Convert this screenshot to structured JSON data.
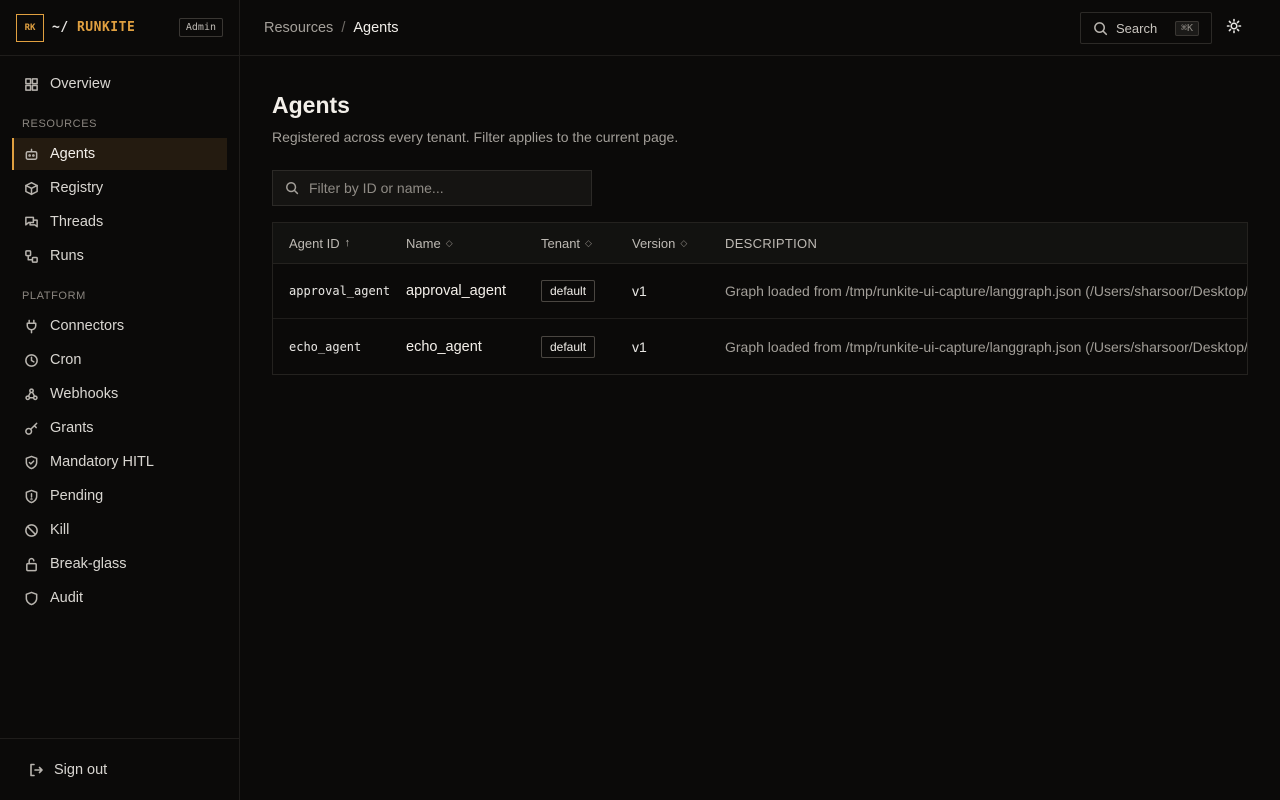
{
  "brand": {
    "logo": "RK",
    "prefix": "~/",
    "name": "RUNKITE",
    "badge": "Admin"
  },
  "sidebar": {
    "overview": "Overview",
    "resources_heading": "RESOURCES",
    "resources": [
      "Agents",
      "Registry",
      "Threads",
      "Runs"
    ],
    "platform_heading": "PLATFORM",
    "platform": [
      "Connectors",
      "Cron",
      "Webhooks",
      "Grants",
      "Mandatory HITL",
      "Pending",
      "Kill",
      "Break-glass",
      "Audit"
    ],
    "signout": "Sign out"
  },
  "topbar": {
    "crumb_parent": "Resources",
    "crumb_sep": "/",
    "crumb_current": "Agents",
    "search_label": "Search",
    "search_kbd": "⌘K"
  },
  "main": {
    "title": "Agents",
    "subtitle": "Registered across every tenant. Filter applies to the current page.",
    "filter_placeholder": "Filter by ID or name..."
  },
  "table": {
    "headers": [
      "Agent ID",
      "Name",
      "Tenant",
      "Version",
      "DESCRIPTION"
    ],
    "sort_asc": "↑",
    "sort_none": "◇",
    "rows": [
      {
        "id": "approval_agent",
        "name": "approval_agent",
        "tenant": "default",
        "version": "v1",
        "description": "Graph loaded from /tmp/runkite-ui-capture/langgraph.json (/Users/sharsoor/Desktop/runkite/examples/approval_agent)"
      },
      {
        "id": "echo_agent",
        "name": "echo_agent",
        "tenant": "default",
        "version": "v1",
        "description": "Graph loaded from /tmp/runkite-ui-capture/langgraph.json (/Users/sharsoor/Desktop/runkite/examples/echo_agent)"
      }
    ]
  },
  "colors": {
    "accent": "#e0a040",
    "background": "#0b0a09",
    "active_bg": "#241b10"
  }
}
